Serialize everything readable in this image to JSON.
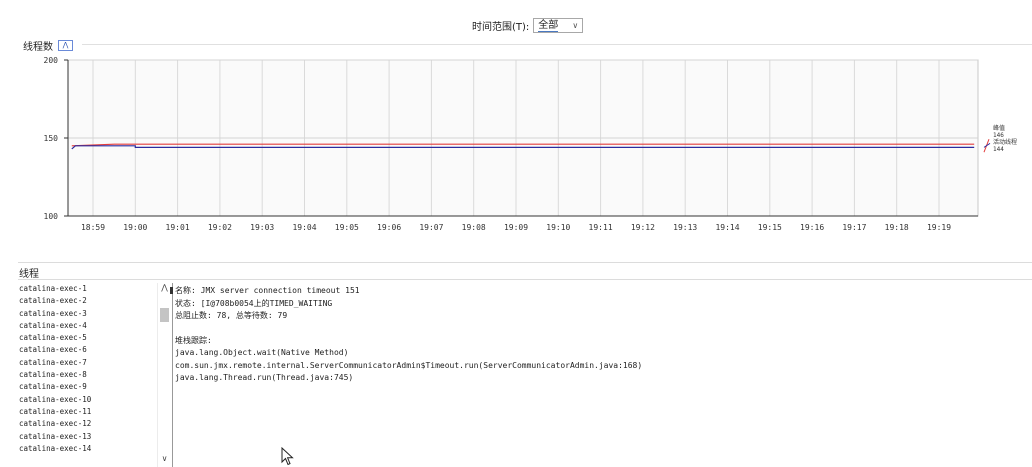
{
  "time_range": {
    "label": "时间范围(T):",
    "selected": "全部"
  },
  "panel": {
    "title": "线程数",
    "collapse_icon": "chevron-up-icon"
  },
  "chart_data": {
    "type": "line",
    "title": "",
    "ylim": [
      100,
      200
    ],
    "yticks": [
      200,
      150,
      100
    ],
    "xticks": [
      "18:59",
      "19:00",
      "19:01",
      "19:02",
      "19:03",
      "19:04",
      "19:05",
      "19:06",
      "19:07",
      "19:08",
      "19:09",
      "19:10",
      "19:11",
      "19:12",
      "19:13",
      "19:14",
      "19:15",
      "19:16",
      "19:17",
      "19:18",
      "19:19"
    ],
    "series": [
      {
        "name": "峰值",
        "color": "#e23c3c",
        "last_value": "146",
        "points": [
          [
            "18:58:30",
            145
          ],
          [
            "18:59:30",
            146
          ],
          [
            "19:00",
            146
          ],
          [
            "19:19:50",
            146
          ]
        ]
      },
      {
        "name": "活动线程",
        "color": "#2b2b9e",
        "last_value": "144",
        "points": [
          [
            "18:58:30",
            143
          ],
          [
            "18:58:35",
            145
          ],
          [
            "19:00",
            145
          ],
          [
            "19:00",
            144
          ],
          [
            "19:19:50",
            144
          ]
        ]
      }
    ]
  },
  "tab": {
    "label": "线程"
  },
  "threads": [
    "catalina-exec-1",
    "catalina-exec-2",
    "catalina-exec-3",
    "catalina-exec-4",
    "catalina-exec-5",
    "catalina-exec-6",
    "catalina-exec-7",
    "catalina-exec-8",
    "catalina-exec-9",
    "catalina-exec-10",
    "catalina-exec-11",
    "catalina-exec-12",
    "catalina-exec-13",
    "catalina-exec-14"
  ],
  "detail": {
    "name": "名称: JMX server connection timeout 151",
    "state": "状态: [I@708b0054上的TIMED_WAITING",
    "counts": "总阻止数: 78, 总等待数: 79",
    "stack_header": "堆栈跟踪:",
    "stack": [
      "java.lang.Object.wait(Native Method)",
      "com.sun.jmx.remote.internal.ServerCommunicatorAdmin$Timeout.run(ServerCommunicatorAdmin.java:168)",
      "java.lang.Thread.run(Thread.java:745)"
    ]
  }
}
